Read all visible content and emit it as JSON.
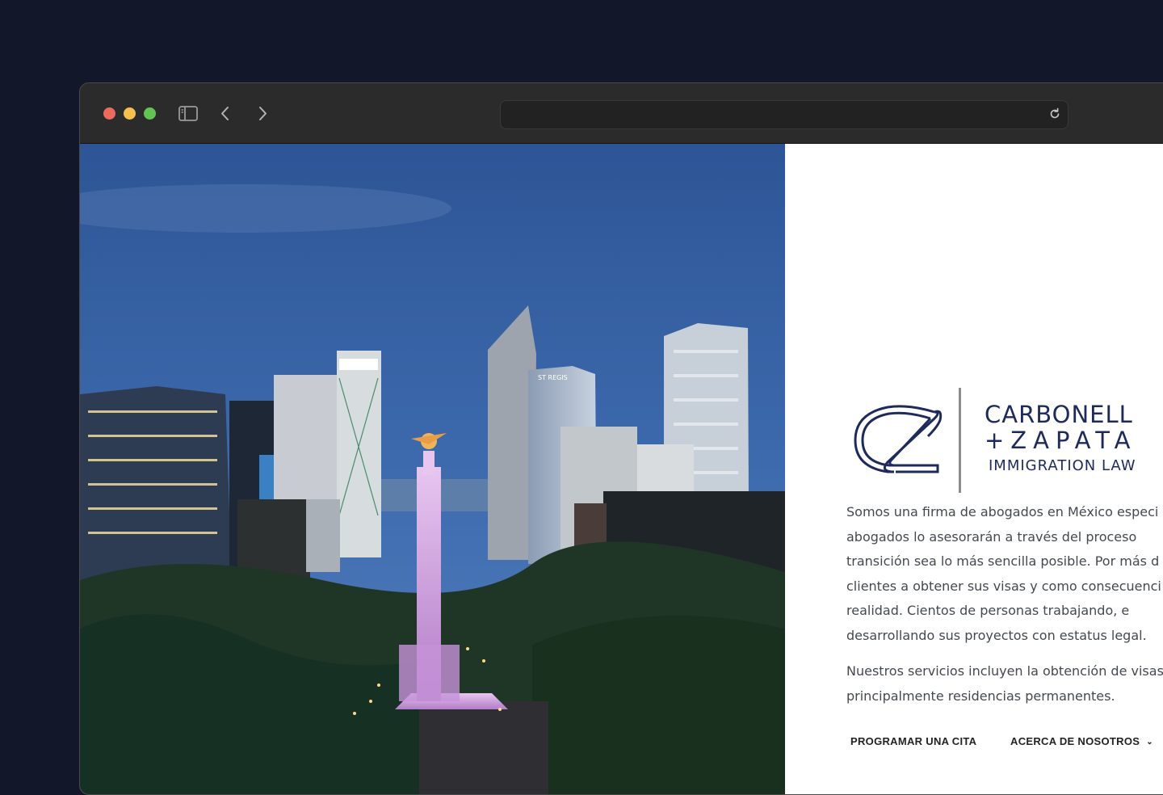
{
  "browser": {
    "address_value": "",
    "icons": [
      "sidebar-icon",
      "back-arrow-icon",
      "forward-arrow-icon",
      "reload-icon"
    ]
  },
  "hero": {
    "image_subject": "night-city-skyline-photo",
    "sign_text": "ST REGIS"
  },
  "logo": {
    "monogram": "CZ",
    "line1": "CARBONELL",
    "line2": "+ZAPATA",
    "line3": "IMMIGRATION LAW",
    "color": "#1f2a5c"
  },
  "intro": {
    "paragraph1": [
      "Somos una firma de abogados en México especi",
      "abogados lo asesorarán a través del proceso",
      "transición sea lo más sencilla posible. Por más d",
      "clientes a obtener sus visas y como consecuenci",
      "realidad. Cientos de personas trabajando, e",
      "desarrollando sus proyectos con estatus legal."
    ],
    "paragraph2": [
      "Nuestros servicios incluyen la obtención de visas c",
      "principalmente residencias permanentes."
    ]
  },
  "nav": {
    "schedule_label": "PROGRAMAR UNA CITA",
    "about_label": "ACERCA DE NOSOTROS"
  },
  "colors": {
    "page_bg": "#121829",
    "browser_chrome": "#2c2b2c",
    "brand_navy": "#1f2a5c"
  }
}
